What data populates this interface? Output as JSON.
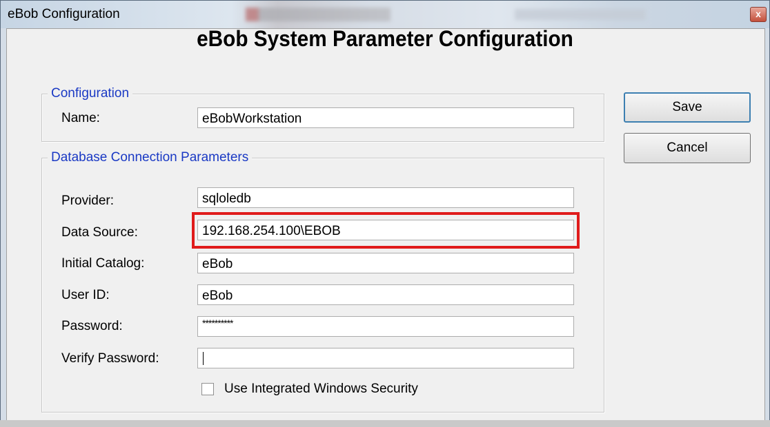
{
  "window": {
    "title": "eBob Configuration",
    "close_glyph": "x"
  },
  "heading": "eBob System Parameter Configuration",
  "configuration": {
    "legend": "Configuration",
    "name_label": "Name:",
    "name_value": "eBobWorkstation"
  },
  "database": {
    "legend": "Database Connection Parameters",
    "provider_label": "Provider:",
    "provider_value": "sqloledb",
    "data_source_label": "Data Source:",
    "data_source_value": "192.168.254.100\\EBOB",
    "initial_catalog_label": "Initial Catalog:",
    "initial_catalog_value": "eBob",
    "user_id_label": "User ID:",
    "user_id_value": "eBob",
    "password_label": "Password:",
    "password_value": "**********",
    "verify_password_label": "Verify Password:",
    "verify_password_value": "",
    "integrated_security_label": "Use Integrated Windows Security",
    "integrated_security_checked": false
  },
  "buttons": {
    "save": "Save",
    "cancel": "Cancel"
  },
  "colors": {
    "legend_text": "#1a39c4",
    "highlight_border": "#e01b1b",
    "default_button_border": "#3c7fb1"
  },
  "icons": [
    "close-icon",
    "checkbox-icon"
  ]
}
